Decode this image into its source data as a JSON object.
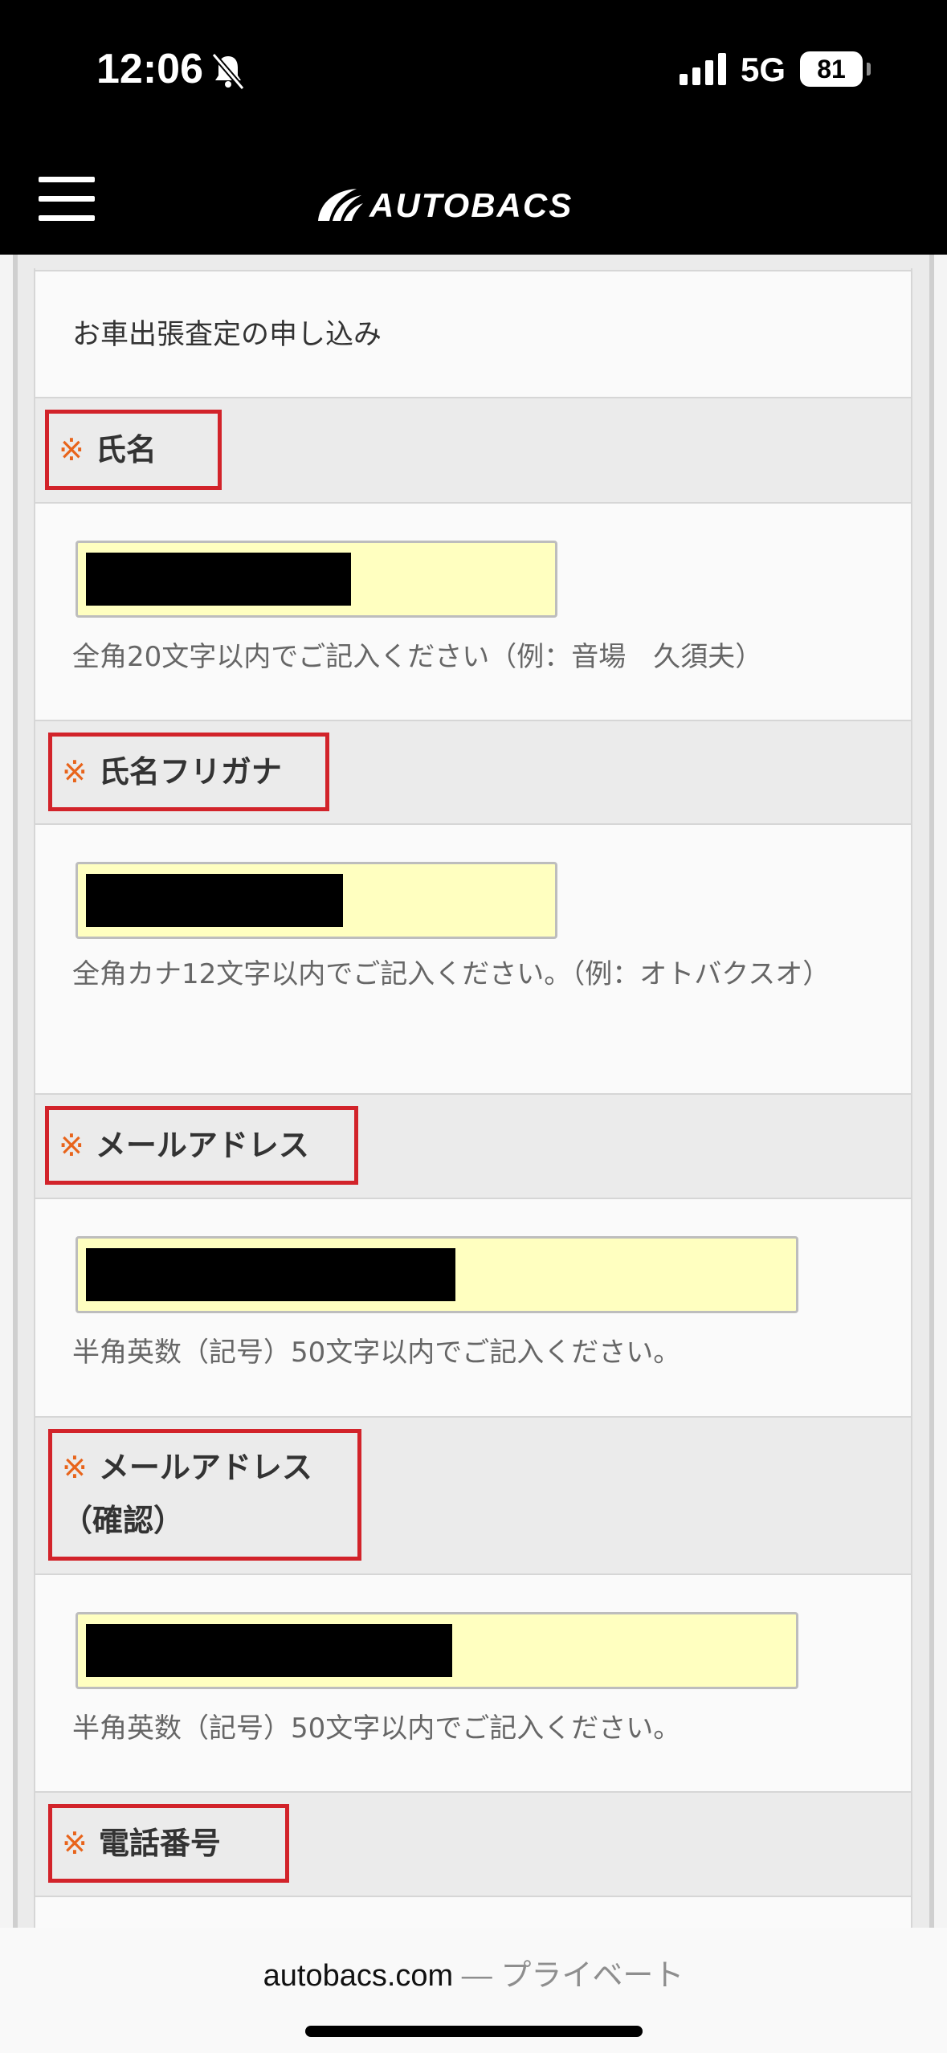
{
  "status": {
    "time": "12:06",
    "network": "5G",
    "battery": "81"
  },
  "header": {
    "logo": "AUTOBACS",
    "menu_icon": "hamburger-menu-icon"
  },
  "form": {
    "intro_text": "お車出張査定の申し込み",
    "required_mark": "※",
    "fields": [
      {
        "label": "氏名",
        "help": "全角20文字以内でご記入ください（例：音場　久須夫）"
      },
      {
        "label": "氏名フリガナ",
        "help": "全角カナ12文字以内でご記入ください。（例：オトバクスオ）"
      },
      {
        "label": "メールアドレス",
        "help": "半角英数（記号）50文字以内でご記入ください。"
      },
      {
        "label": "メールアドレス（確認）",
        "help": "半角英数（記号）50文字以内でご記入ください。"
      },
      {
        "label": "電話番号"
      }
    ]
  },
  "browser": {
    "domain": "autobacs.com",
    "suffix": " — プライベート"
  },
  "colors": {
    "input_bg": "#ffffc0",
    "highlight_border": "#d2232a",
    "required": "#e8641b"
  }
}
